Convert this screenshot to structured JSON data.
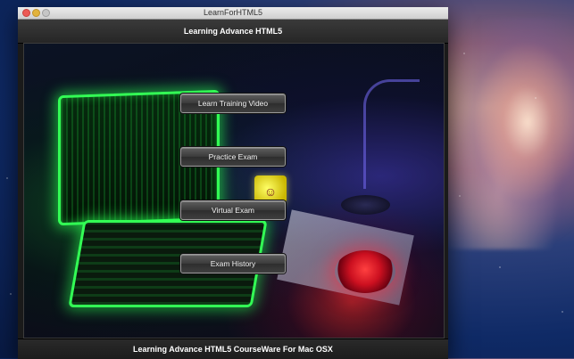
{
  "window": {
    "title": "LearnForHTML5"
  },
  "header": {
    "title": "Learning Advance HTML5"
  },
  "menu": {
    "buttons": [
      {
        "label": "Learn Training Video"
      },
      {
        "label": "Practice Exam"
      },
      {
        "label": "Virtual Exam"
      },
      {
        "label": "Exam History"
      }
    ]
  },
  "footer": {
    "text": "Learning Advance HTML5 CourseWare For Mac OSX"
  },
  "icons": [
    "close-icon",
    "minimize-icon",
    "zoom-icon"
  ],
  "colors": {
    "glow_green": "#33ff55",
    "window_bg": "#1a1a1a",
    "header_text": "#ffffff"
  }
}
